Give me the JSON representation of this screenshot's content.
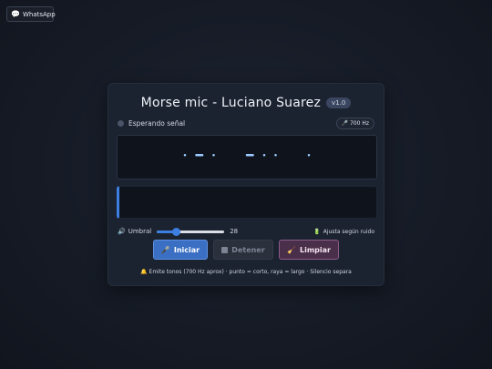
{
  "whatsapp": {
    "label": "WhatsApp",
    "icon": "speech-bubble-icon"
  },
  "header": {
    "title": "Morse mic - Luciano Suarez",
    "version": "v1.0"
  },
  "status": {
    "text": "Esperando señal",
    "frequency": "🎤 700 Hz"
  },
  "morse": {
    "symbols": [
      ".",
      "-",
      ".",
      " ",
      "-",
      ".",
      ".",
      " ",
      "."
    ]
  },
  "decoded_text": "",
  "threshold": {
    "label": "Umbral",
    "value": "28",
    "level": 28,
    "max": 100
  },
  "auto_noise": {
    "label": "Ajusta según ruido"
  },
  "buttons": {
    "start": "Iniciar",
    "stop": "Detener",
    "clear": "Limpiar"
  },
  "hint": "🔔 Emite tonos (700 Hz aprox) · punto = corto, raya = largo · Silencio separa",
  "colors": {
    "accent": "#3d7fe0",
    "signal": "#9cc8ff"
  }
}
